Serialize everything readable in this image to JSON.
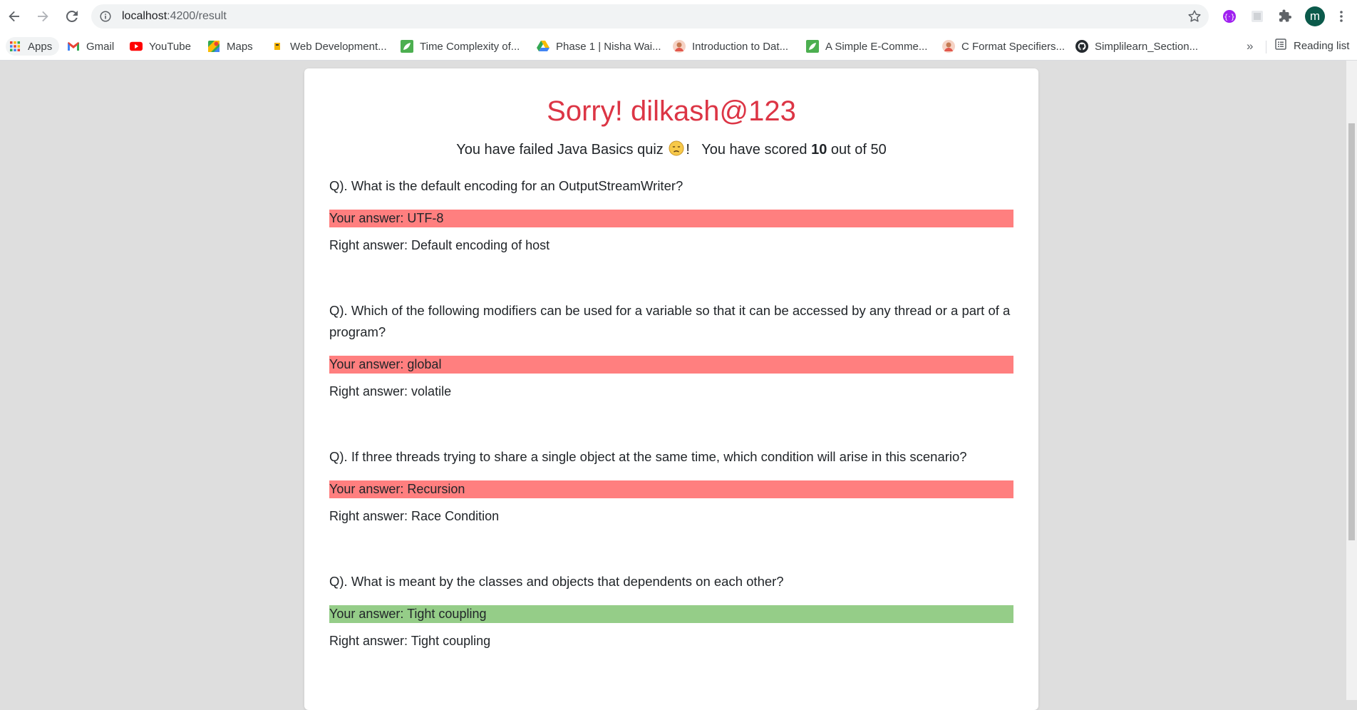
{
  "browser": {
    "url_host": "localhost",
    "url_path": ":4200/result",
    "avatar_letter": "m",
    "bookmarks": [
      {
        "label": "Apps",
        "icon": "apps-grid-icon"
      },
      {
        "label": "Gmail",
        "icon": "gmail-icon"
      },
      {
        "label": "YouTube",
        "icon": "youtube-icon"
      },
      {
        "label": "Maps",
        "icon": "maps-icon"
      },
      {
        "label": "Web Development...",
        "icon": "bookmark-favicon"
      },
      {
        "label": "Time Complexity of...",
        "icon": "leaf-favicon"
      },
      {
        "label": "Phase 1 | Nisha Wai...",
        "icon": "drive-icon"
      },
      {
        "label": "Introduction to Dat...",
        "icon": "profile-favicon"
      },
      {
        "label": "A Simple E-Comme...",
        "icon": "leaf-favicon"
      },
      {
        "label": "C Format Specifiers...",
        "icon": "profile-favicon"
      },
      {
        "label": "Simplilearn_Section...",
        "icon": "github-icon"
      }
    ],
    "more_label": "»",
    "reading_list_label": "Reading list"
  },
  "result": {
    "title": "Sorry! dilkash@123",
    "summary_prefix": "You have failed Java Basics quiz",
    "summary_after_emoji": "!",
    "summary_scored": "You have scored",
    "score": "10",
    "summary_total": "out of 50",
    "emoji": "disappointed-face-icon"
  },
  "questions": [
    {
      "question": "Q). What is the default encoding for an OutputStreamWriter?",
      "your_answer": "Your answer: UTF-8",
      "right_answer": "Right answer: Default encoding of host",
      "correct": false
    },
    {
      "question": "Q). Which of the following modifiers can be used for a variable so that it can be accessed by any thread or a part of a program?",
      "your_answer": "Your answer: global",
      "right_answer": "Right answer: volatile",
      "correct": false
    },
    {
      "question": "Q). If three threads trying to share a single object at the same time, which condition will arise in this scenario?",
      "your_answer": "Your answer: Recursion",
      "right_answer": "Right answer: Race Condition",
      "correct": false
    },
    {
      "question": "Q). What is meant by the classes and objects that dependents on each other?",
      "your_answer": "Your answer: Tight coupling",
      "right_answer": "Right answer: Tight coupling",
      "correct": true
    }
  ],
  "colors": {
    "wrong_answer_bg": "#ff7f7f",
    "right_answer_bg": "#95cd88",
    "title_red": "#dc3545"
  }
}
